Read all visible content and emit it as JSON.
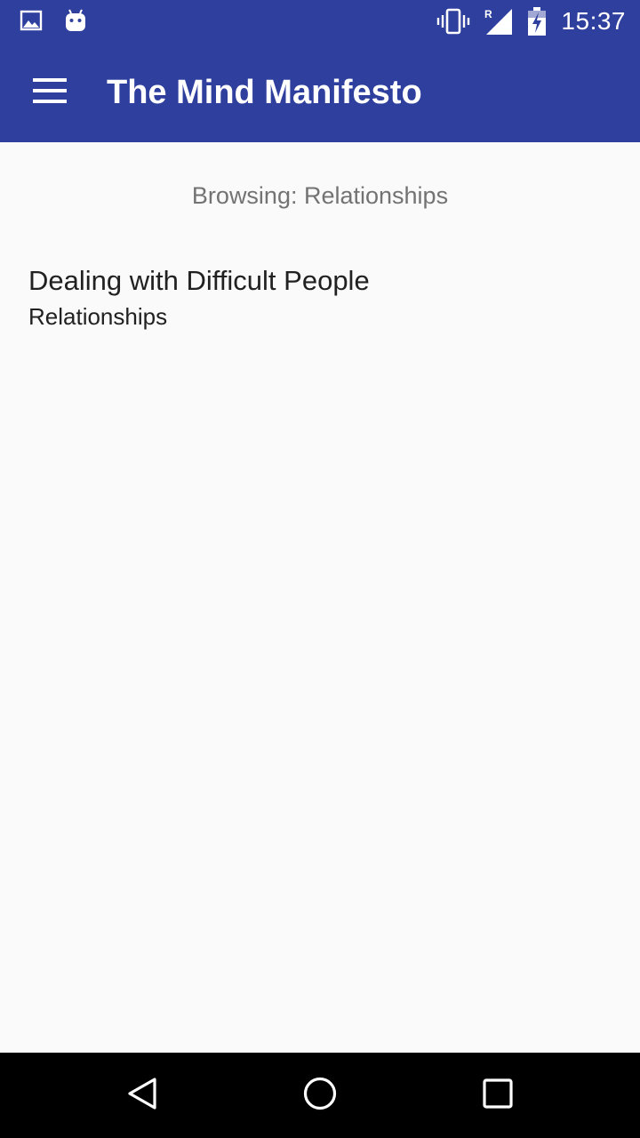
{
  "status_bar": {
    "time": "15:37",
    "left_icons": [
      "image-icon",
      "android-icon"
    ],
    "right_icons": [
      "vibrate-icon",
      "signal-roaming-icon",
      "battery-charging-icon"
    ],
    "roaming_indicator": "R"
  },
  "app_bar": {
    "title": "The Mind Manifesto",
    "menu_icon": "hamburger-menu-icon",
    "background_color": "#2e3f9e"
  },
  "content": {
    "browsing_label": "Browsing: Relationships",
    "articles": [
      {
        "title": "Dealing with Difficult People",
        "category": "Relationships"
      }
    ]
  },
  "nav_bar": {
    "icons": [
      "back-icon",
      "home-icon",
      "recent-apps-icon"
    ]
  }
}
